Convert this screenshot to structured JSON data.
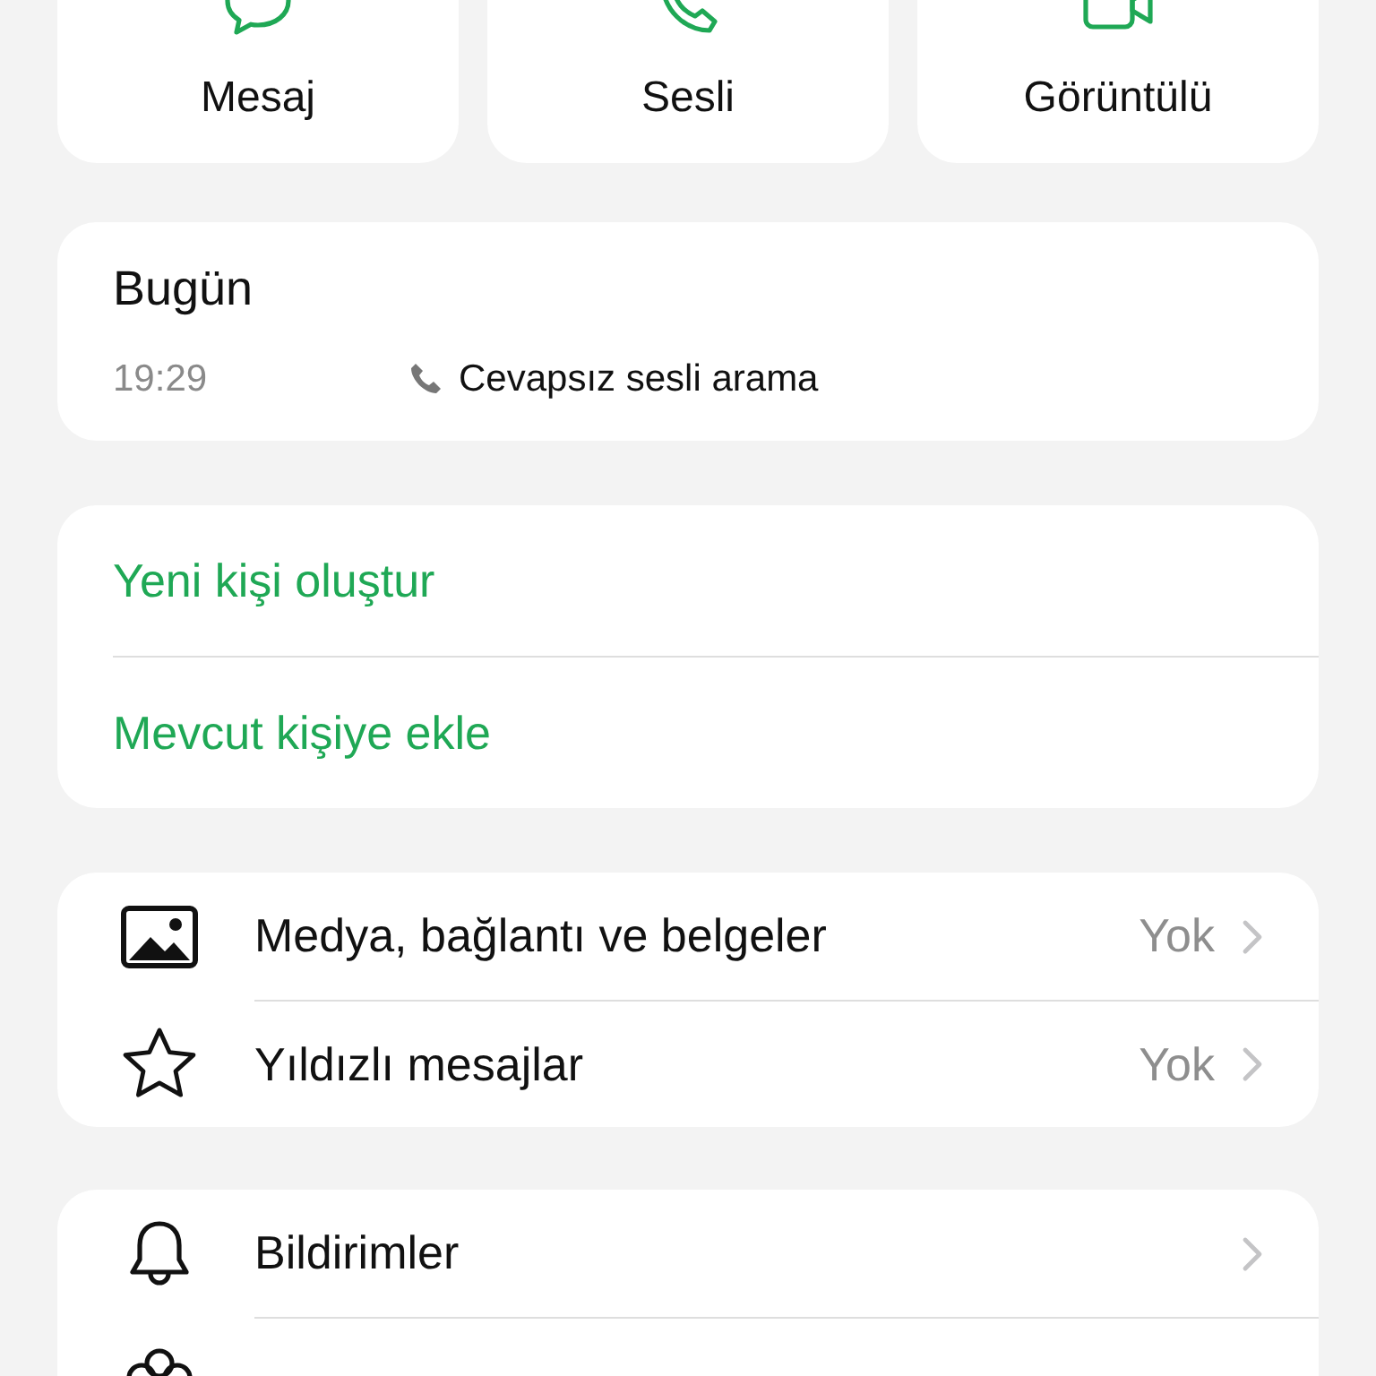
{
  "actions": [
    {
      "kind": "message",
      "label": "Mesaj"
    },
    {
      "kind": "voice",
      "label": "Sesli"
    },
    {
      "kind": "video",
      "label": "Görüntülü"
    }
  ],
  "calls": {
    "heading": "Bugün",
    "entries": [
      {
        "time": "19:29",
        "description": "Cevapsız sesli arama"
      }
    ]
  },
  "contact_actions": [
    "Yeni kişi oluştur",
    "Mevcut kişiye ekle"
  ],
  "info_rows": [
    {
      "kind": "media",
      "label": "Medya, bağlantı ve belgeler",
      "value": "Yok"
    },
    {
      "kind": "star",
      "label": "Yıldızlı mesajlar",
      "value": "Yok"
    }
  ],
  "settings_rows": [
    {
      "kind": "bell",
      "label": "Bildirimler"
    },
    {
      "kind": "flower"
    }
  ]
}
